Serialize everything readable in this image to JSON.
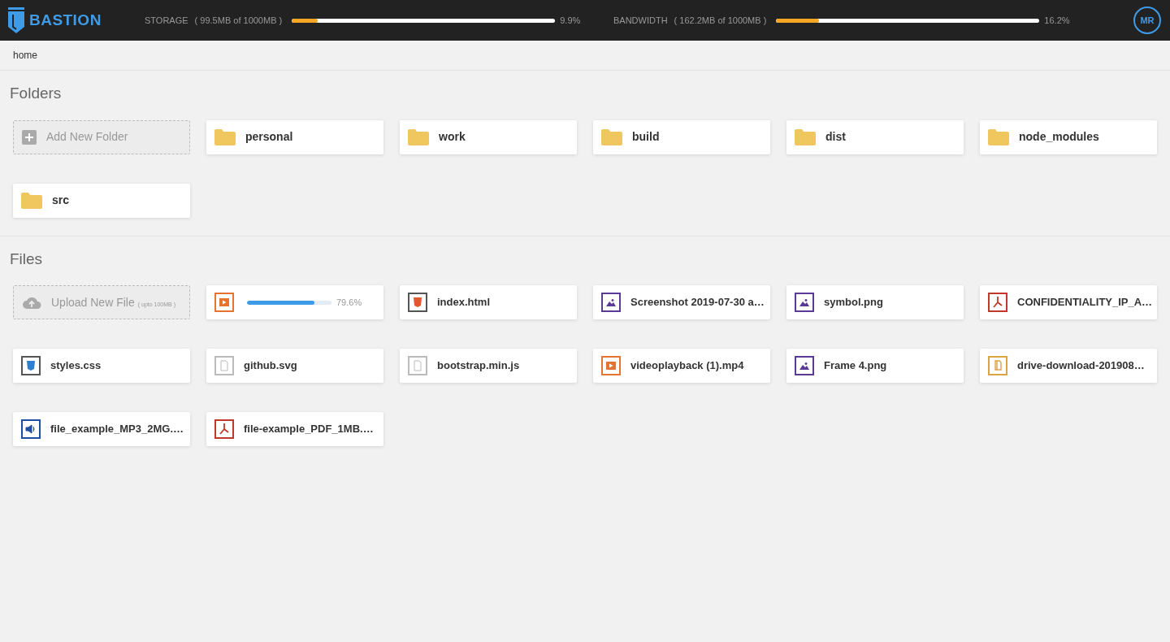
{
  "header": {
    "logo": "BASTION",
    "meters": [
      {
        "label": "STORAGE",
        "detail": "( 99.5MB of 1000MB )",
        "level": 0.099,
        "reading": "9.9%"
      },
      {
        "label": "BANDWIDTH",
        "detail": "( 162.2MB of 1000MB )",
        "level": 0.162,
        "reading": "16.2%"
      }
    ],
    "avatar": "MR"
  },
  "breadcrumb": [
    "home"
  ],
  "folders": {
    "title": "Folders",
    "add_label": "Add New Folder",
    "items": [
      {
        "name": "personal"
      },
      {
        "name": "work"
      },
      {
        "name": "build"
      },
      {
        "name": "dist"
      },
      {
        "name": "node_modules"
      },
      {
        "name": "src"
      }
    ]
  },
  "files": {
    "title": "Files",
    "upload_label": "Upload New File",
    "upload_note": "( upto 100MB )",
    "items": [
      {
        "kind": "uploading",
        "level": 0.796,
        "reading": "79.6%"
      },
      {
        "kind": "html",
        "name": "index.html"
      },
      {
        "kind": "image",
        "name": "Screenshot 2019-07-30 a…"
      },
      {
        "kind": "image",
        "name": "symbol.png"
      },
      {
        "kind": "pdf",
        "name": "CONFIDENTIALITY_IP_A…"
      },
      {
        "kind": "css",
        "name": "styles.css"
      },
      {
        "kind": "generic",
        "name": "github.svg"
      },
      {
        "kind": "generic",
        "name": "bootstrap.min.js"
      },
      {
        "kind": "video",
        "name": "videoplayback (1).mp4"
      },
      {
        "kind": "image",
        "name": "Frame 4.png"
      },
      {
        "kind": "archive",
        "name": "drive-download-201908…"
      },
      {
        "kind": "audio",
        "name": "file_example_MP3_2MG.…"
      },
      {
        "kind": "pdf",
        "name": "file-example_PDF_1MB.…"
      }
    ]
  }
}
